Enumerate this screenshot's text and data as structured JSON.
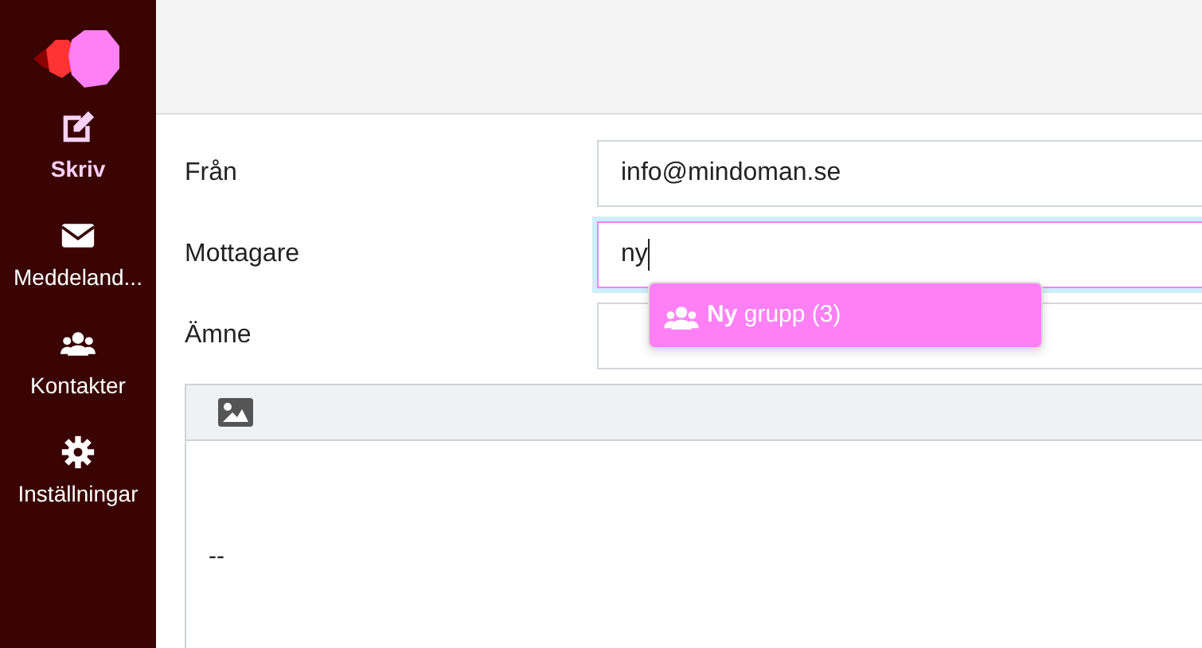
{
  "sidebar": {
    "items": [
      {
        "label": "Skriv",
        "kind": "compose",
        "selected": true
      },
      {
        "label": "Meddeland...",
        "kind": "mail",
        "selected": false
      },
      {
        "label": "Kontakter",
        "kind": "contacts",
        "selected": false
      },
      {
        "label": "Inställningar",
        "kind": "settings",
        "selected": false
      }
    ]
  },
  "form": {
    "fields": [
      {
        "label": "Från",
        "value": "info@mindoman.se",
        "focused": false
      },
      {
        "label": "Mottagare",
        "value": "ny",
        "focused": true
      },
      {
        "label": "Ämne",
        "focused": false
      }
    ]
  },
  "suggestions": [
    {
      "text": "**Ny** grupp (3)",
      "selected": true
    }
  ],
  "editor": {
    "body": "--"
  }
}
